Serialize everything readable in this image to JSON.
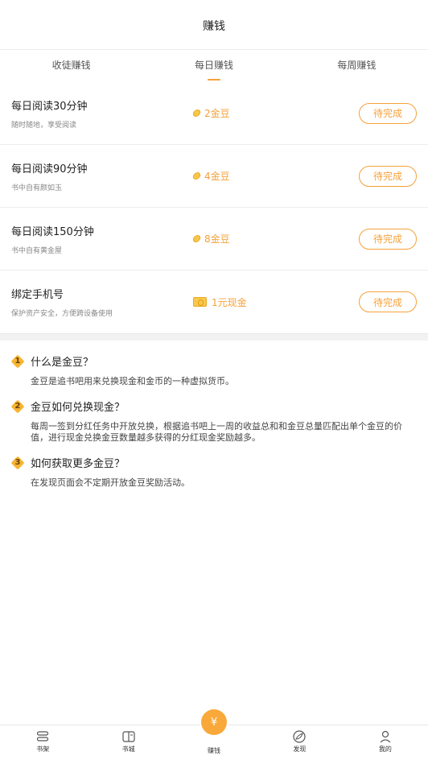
{
  "header": {
    "title": "赚钱"
  },
  "tabs": [
    {
      "label": "收徒赚钱",
      "active": false
    },
    {
      "label": "每日赚钱",
      "active": true
    },
    {
      "label": "每周赚钱",
      "active": false
    }
  ],
  "tasks": [
    {
      "name": "每日阅读30分钟",
      "sub": "随时随地，享受阅读",
      "reward": "2金豆",
      "reward_icon": "coin-icon",
      "button": "待完成"
    },
    {
      "name": "每日阅读90分钟",
      "sub": "书中自有颜如玉",
      "reward": "4金豆",
      "reward_icon": "coin-icon",
      "button": "待完成"
    },
    {
      "name": "每日阅读150分钟",
      "sub": "书中自有黄金屋",
      "reward": "8金豆",
      "reward_icon": "coin-icon",
      "button": "待完成"
    },
    {
      "name": "绑定手机号",
      "sub": "保护资产安全，方便跨设备使用",
      "reward": "1元现金",
      "reward_icon": "cash-icon",
      "button": "待完成"
    }
  ],
  "faq": [
    {
      "num": "1",
      "q": "什么是金豆？",
      "a": "金豆是追书吧用来兑换现金和金币的一种虚拟货币。"
    },
    {
      "num": "2",
      "q": "金豆如何兑换现金？",
      "a": "每周一签到分红任务中开放兑换，根据追书吧上一周的收益总和和金豆总量匹配出单个金豆的价值，进行现金兑换金豆数量越多获得的分红现金奖励越多。"
    },
    {
      "num": "3",
      "q": "如何获取更多金豆？",
      "a": "在发现页面会不定期开放金豆奖励活动。"
    }
  ],
  "bottom_nav": [
    {
      "label": "书架",
      "icon": "bookshelf-icon"
    },
    {
      "label": "书城",
      "icon": "bookstore-icon"
    },
    {
      "label": "赚钱",
      "icon": "money-bag-icon",
      "badge": "¥"
    },
    {
      "label": "发现",
      "icon": "discover-icon"
    },
    {
      "label": "我的",
      "icon": "profile-icon"
    }
  ],
  "colors": {
    "accent": "#f5a13a",
    "coin": "#f9c64a",
    "divider": "#f2f2f2"
  }
}
